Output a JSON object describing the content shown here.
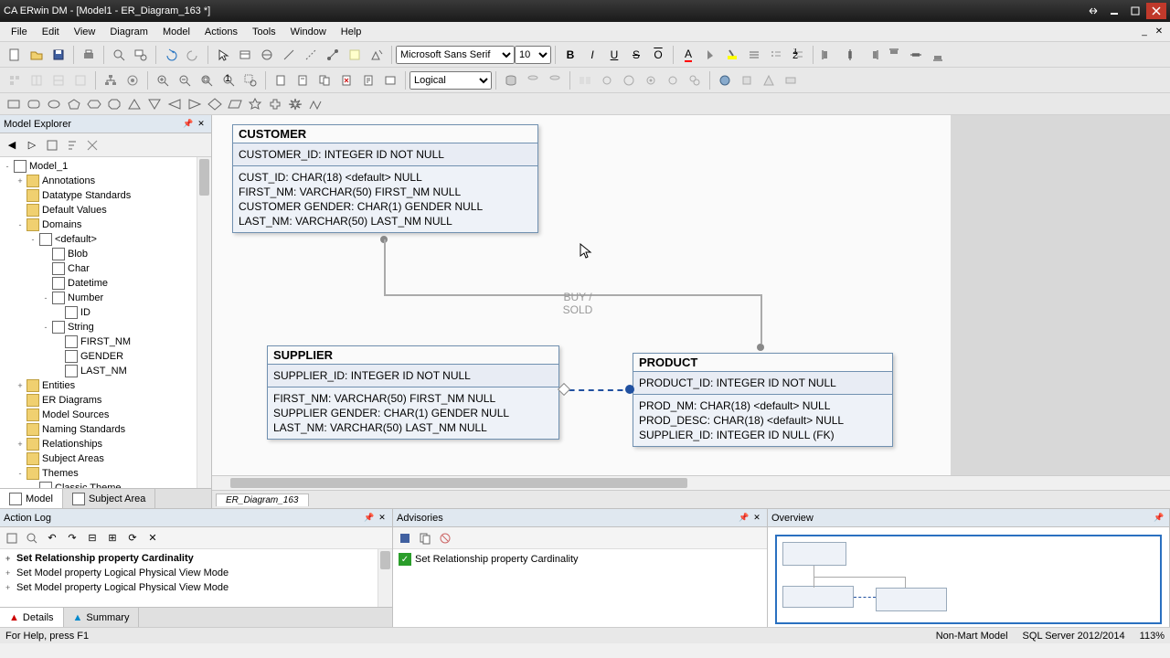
{
  "titlebar": {
    "text": "CA ERwin DM - [Model1 - ER_Diagram_163 *]"
  },
  "menu": {
    "items": [
      "File",
      "Edit",
      "View",
      "Diagram",
      "Model",
      "Actions",
      "Tools",
      "Window",
      "Help"
    ]
  },
  "toolbar": {
    "font": "Microsoft Sans Serif",
    "fontsize": "10",
    "viewmode": "Logical"
  },
  "explorer": {
    "title": "Model Explorer",
    "tabs": {
      "model": "Model",
      "subject": "Subject Area"
    },
    "tree": [
      {
        "lvl": 0,
        "exp": "-",
        "label": "Model_1",
        "icon": "model"
      },
      {
        "lvl": 1,
        "exp": "+",
        "label": "Annotations",
        "icon": "folder"
      },
      {
        "lvl": 1,
        "exp": "",
        "label": "Datatype Standards",
        "icon": "folder"
      },
      {
        "lvl": 1,
        "exp": "",
        "label": "Default Values",
        "icon": "folder"
      },
      {
        "lvl": 1,
        "exp": "-",
        "label": "Domains",
        "icon": "folder"
      },
      {
        "lvl": 2,
        "exp": "-",
        "label": "<default>",
        "icon": "dom"
      },
      {
        "lvl": 3,
        "exp": "",
        "label": "Blob",
        "icon": "dom"
      },
      {
        "lvl": 3,
        "exp": "",
        "label": "Char",
        "icon": "dom"
      },
      {
        "lvl": 3,
        "exp": "",
        "label": "Datetime",
        "icon": "dom"
      },
      {
        "lvl": 3,
        "exp": "-",
        "label": "Number",
        "icon": "dom"
      },
      {
        "lvl": 4,
        "exp": "",
        "label": "ID",
        "icon": "dom"
      },
      {
        "lvl": 3,
        "exp": "-",
        "label": "String",
        "icon": "dom"
      },
      {
        "lvl": 4,
        "exp": "",
        "label": "FIRST_NM",
        "icon": "dom"
      },
      {
        "lvl": 4,
        "exp": "",
        "label": "GENDER",
        "icon": "dom"
      },
      {
        "lvl": 4,
        "exp": "",
        "label": "LAST_NM",
        "icon": "dom"
      },
      {
        "lvl": 1,
        "exp": "+",
        "label": "Entities",
        "icon": "folder"
      },
      {
        "lvl": 1,
        "exp": "",
        "label": "ER Diagrams",
        "icon": "folder"
      },
      {
        "lvl": 1,
        "exp": "",
        "label": "Model Sources",
        "icon": "folder"
      },
      {
        "lvl": 1,
        "exp": "",
        "label": "Naming Standards",
        "icon": "folder"
      },
      {
        "lvl": 1,
        "exp": "+",
        "label": "Relationships",
        "icon": "folder"
      },
      {
        "lvl": 1,
        "exp": "",
        "label": "Subject Areas",
        "icon": "folder"
      },
      {
        "lvl": 1,
        "exp": "-",
        "label": "Themes",
        "icon": "folder"
      },
      {
        "lvl": 2,
        "exp": "",
        "label": "Classic Theme",
        "icon": "theme"
      }
    ]
  },
  "diagram": {
    "tab": "ER_Diagram_163",
    "customer": {
      "name": "CUSTOMER",
      "pk": "CUSTOMER_ID: INTEGER ID NOT NULL",
      "rows": [
        "CUST_ID: CHAR(18) <default> NULL",
        "FIRST_NM: VARCHAR(50) FIRST_NM NULL",
        "CUSTOMER GENDER: CHAR(1) GENDER NULL",
        "LAST_NM: VARCHAR(50) LAST_NM NULL"
      ]
    },
    "supplier": {
      "name": "SUPPLIER",
      "pk": "SUPPLIER_ID: INTEGER ID NOT NULL",
      "rows": [
        "FIRST_NM: VARCHAR(50) FIRST_NM NULL",
        "SUPPLIER GENDER: CHAR(1) GENDER NULL",
        "LAST_NM: VARCHAR(50) LAST_NM NULL"
      ]
    },
    "product": {
      "name": "PRODUCT",
      "pk": "PRODUCT_ID: INTEGER ID NOT NULL",
      "rows": [
        "PROD_NM: CHAR(18) <default> NULL",
        "PROD_DESC: CHAR(18) <default> NULL",
        "SUPPLIER_ID: INTEGER ID NULL (FK)"
      ]
    },
    "rel_label": "BUY /\nSOLD"
  },
  "actionlog": {
    "title": "Action Log",
    "tabs": {
      "details": "Details",
      "summary": "Summary"
    },
    "rows": [
      {
        "bold": true,
        "text": "Set Relationship property Cardinality"
      },
      {
        "bold": false,
        "text": "Set Model property Logical Physical View Mode"
      },
      {
        "bold": false,
        "text": "Set Model property Logical Physical View Mode"
      }
    ]
  },
  "advisories": {
    "title": "Advisories",
    "rows": [
      "Set Relationship property Cardinality"
    ]
  },
  "overview": {
    "title": "Overview"
  },
  "status": {
    "help": "For Help, press F1",
    "mart": "Non-Mart Model",
    "db": "SQL Server 2012/2014",
    "zoom": "113%"
  }
}
